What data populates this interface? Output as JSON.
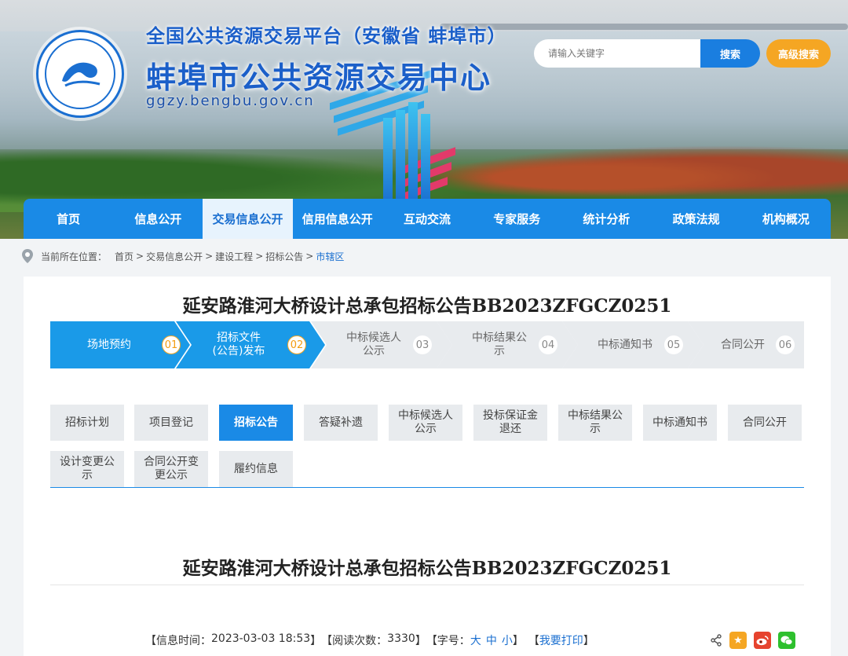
{
  "header": {
    "platform_title": "全国公共资源交易平台（安徽省 蚌埠市）",
    "center_title": "蚌埠市公共资源交易中心",
    "domain": "ggzy.bengbu.gov.cn",
    "search_placeholder": "请输入关键字",
    "search_label": "搜索",
    "advanced_search_label": "高级搜索"
  },
  "nav": {
    "items": [
      {
        "label": "首页"
      },
      {
        "label": "信息公开"
      },
      {
        "label": "交易信息公开"
      },
      {
        "label": "信用信息公开"
      },
      {
        "label": "互动交流"
      },
      {
        "label": "专家服务"
      },
      {
        "label": "统计分析"
      },
      {
        "label": "政策法规"
      },
      {
        "label": "机构概况"
      }
    ],
    "active_index": 2
  },
  "breadcrumb": {
    "prefix": "当前所在位置：",
    "items": [
      "首页",
      "交易信息公开",
      "建设工程",
      "招标公告",
      "市辖区"
    ],
    "separator": ">"
  },
  "page": {
    "title": "延安路淮河大桥设计总承包招标公告BB2023ZFGCZ0251"
  },
  "steps": [
    {
      "line1": "场地预约",
      "line2": "",
      "num": "01",
      "active": true
    },
    {
      "line1": "招标文件",
      "line2": "(公告)发布",
      "num": "02",
      "active": true
    },
    {
      "line1": "中标候选人",
      "line2": "公示",
      "num": "03",
      "active": false
    },
    {
      "line1": "中标结果公",
      "line2": "示",
      "num": "04",
      "active": false
    },
    {
      "line1": "中标通知书",
      "line2": "",
      "num": "05",
      "active": false
    },
    {
      "line1": "合同公开",
      "line2": "",
      "num": "06",
      "active": false
    }
  ],
  "tabs": {
    "row1": [
      {
        "line1": "招标计划",
        "line2": ""
      },
      {
        "line1": "项目登记",
        "line2": ""
      },
      {
        "line1": "招标公告",
        "line2": ""
      },
      {
        "line1": "答疑补遗",
        "line2": ""
      },
      {
        "line1": "中标候选人",
        "line2": "公示"
      },
      {
        "line1": "投标保证金",
        "line2": "退还"
      },
      {
        "line1": "中标结果公",
        "line2": "示"
      },
      {
        "line1": "中标通知书",
        "line2": ""
      },
      {
        "line1": "合同公开",
        "line2": ""
      }
    ],
    "row2": [
      {
        "line1": "设计变更公",
        "line2": "示"
      },
      {
        "line1": "合同公开变",
        "line2": "更公示"
      },
      {
        "line1": "履约信息",
        "line2": ""
      }
    ],
    "active": "招标公告"
  },
  "article": {
    "title": "延安路淮河大桥设计总承包招标公告BB2023ZFGCZ0251",
    "info_time_label": "【信息时间：",
    "info_time": "2023-03-03 18:53",
    "info_time_close": "】",
    "read_count_label": "【阅读次数：",
    "read_count": "3330",
    "read_count_close": "】",
    "font_label": "【字号：",
    "font_large": "大",
    "font_medium": "中",
    "font_small": "小",
    "font_close": "】",
    "print_open": "【",
    "print_label": "我要打印",
    "print_close": "】"
  },
  "colors": {
    "primary": "#1a8ae6",
    "accent_orange": "#f5a623",
    "title_blue": "#1b5fc9"
  }
}
